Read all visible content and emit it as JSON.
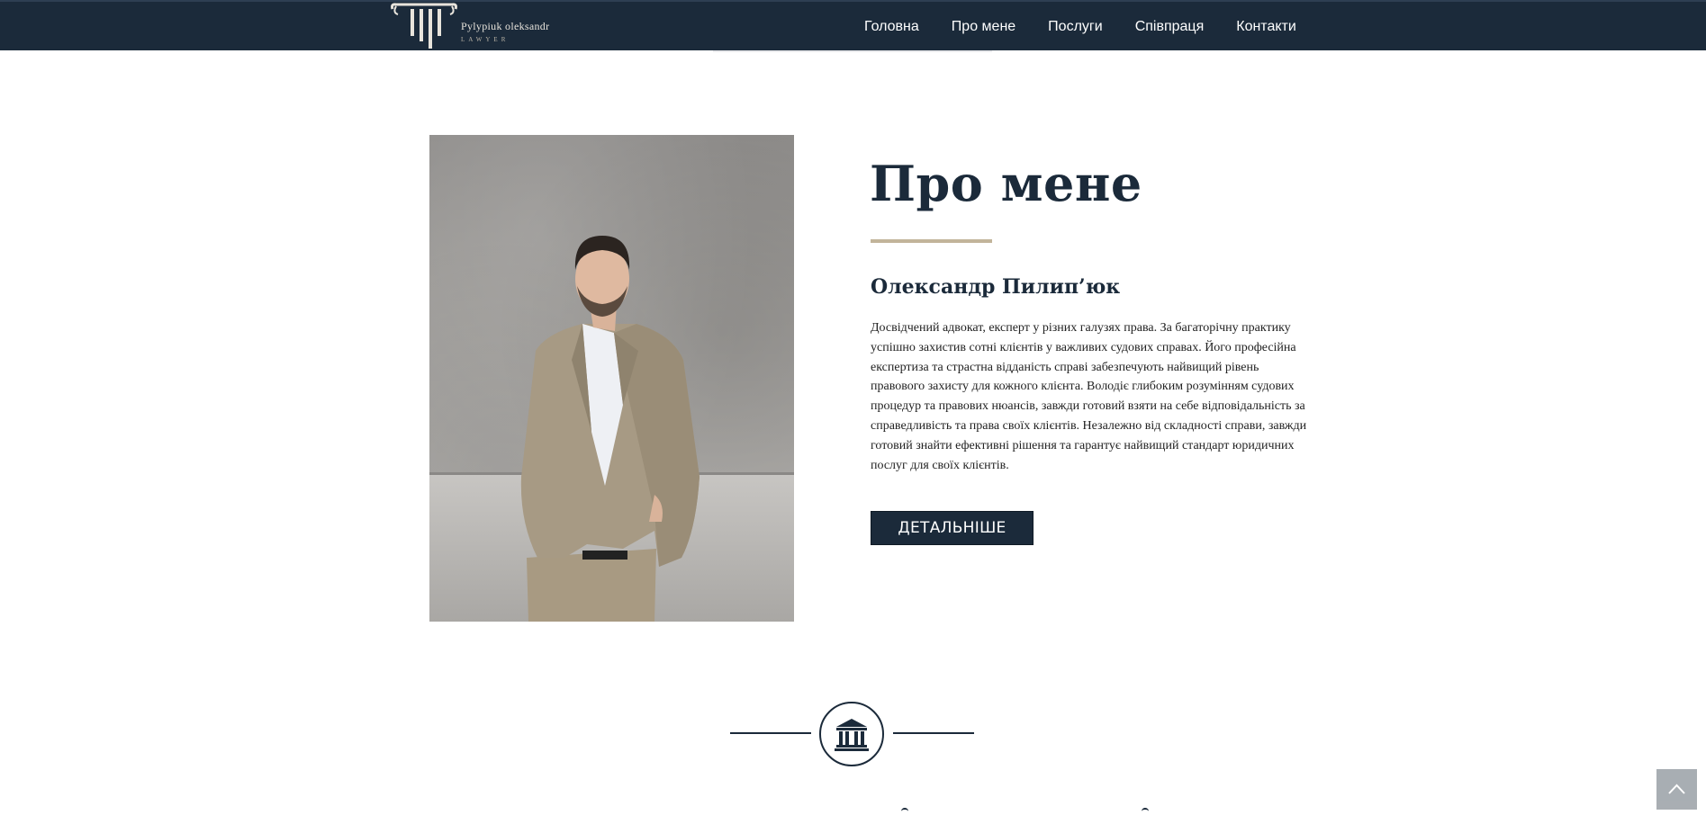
{
  "header": {
    "logo": {
      "name": "Pylypiuk oleksandr",
      "subtitle": "LAWYER",
      "icon": "column-pillar-icon"
    },
    "nav": [
      {
        "label": "Головна"
      },
      {
        "label": "Про мене"
      },
      {
        "label": "Послуги"
      },
      {
        "label": "Співпраця"
      },
      {
        "label": "Контакти"
      }
    ]
  },
  "about": {
    "photo_alt": "portrait-photo",
    "title": "Про мене",
    "name": "Олександр Пилип’юк",
    "bio": "Досвідчений адвокат, експерт у різних галузях права. За багаторічну практику успішно захистив сотні клієнтів у важливих судових справах. Його професійна експертиза та страстна відданість справі забезпечують найвищий рівень правового захисту для кожного клієнта. Володіє глибоким розумінням судових процедур та правових нюансів, завжди готовий взяти на себе відповідальність за справедливість та права своїх клієнтів. Незалежно від складності справи, завжди готовий знайти ефективні рішення та гарантує найвищий стандарт юридичних послуг для своїх клієнтів.",
    "button_label": "ДЕТАЛЬНІШЕ"
  },
  "divider": {
    "icon": "courthouse-icon"
  },
  "back_to_top": {
    "icon": "chevron-up-icon"
  },
  "colors": {
    "navy": "#1b2a3a",
    "gold": "#c2b49a",
    "white": "#ffffff"
  }
}
